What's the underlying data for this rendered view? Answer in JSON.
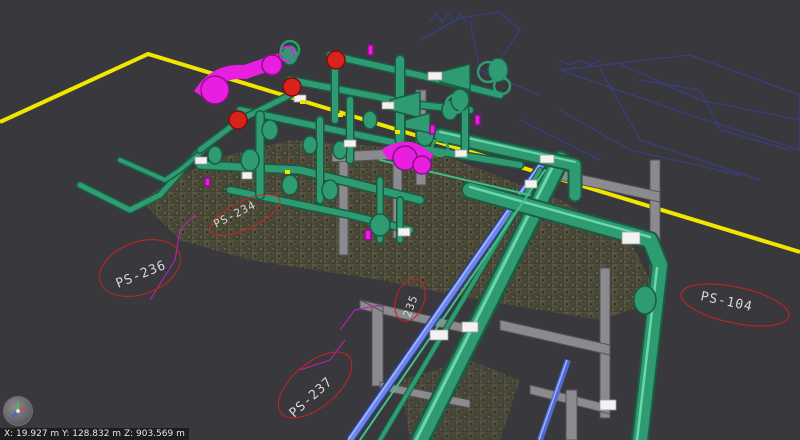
{
  "viewer": {
    "coordinates": "X: 19.927 m   Y: 128.832 m   Z: 903.569 m"
  },
  "tags": {
    "ps236": "PS-236",
    "ps234": "PS-234",
    "ps237": "PS-237",
    "ps235": "235",
    "ps104": "PS-104"
  },
  "colors": {
    "background": "#39393d",
    "pipe": "#2f9b72",
    "pipe_highlight": "#5fd3a4",
    "selected": "#e81ee0",
    "valve_red": "#d8231c",
    "boundary_line": "#f2e600",
    "steel": "#8a8a8f",
    "blue_pipe": "#6b86e8",
    "wireframe": "#3b3f9c",
    "tag_outline": "#cc2222"
  },
  "icons": {
    "orientation_gizmo": "axis-gizmo-icon"
  }
}
